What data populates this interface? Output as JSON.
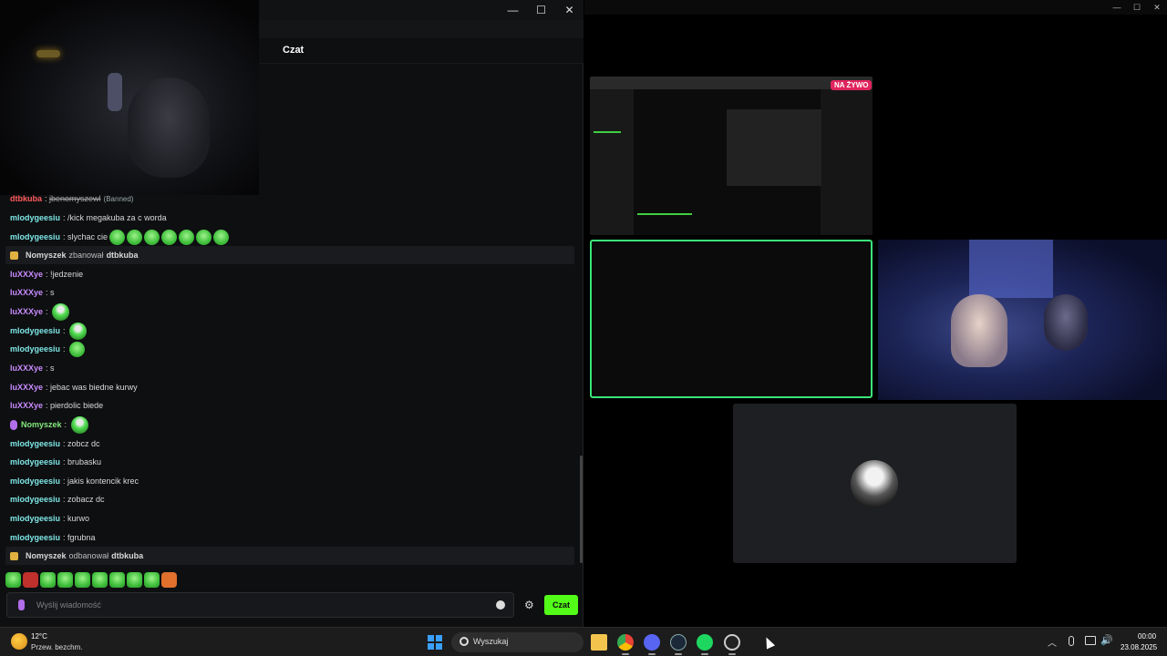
{
  "chat": {
    "header_title": "Czat",
    "window_controls": {
      "minimize": "—",
      "maximize": "☐",
      "close": "✕"
    },
    "messages": [
      {
        "user": "dtbkuba",
        "text": "jbenomyszewl",
        "note": "(Banned)"
      },
      {
        "user": "mlodygeesiu",
        "text": "/kick megakuba za c worda"
      },
      {
        "user": "mlodygeesiu",
        "text": "slychac cie"
      },
      {
        "moderator": "Nomyszek",
        "action": "zbanował",
        "target": "dtbkuba"
      },
      {
        "user": "luXXXye",
        "text": "!jedzenie"
      },
      {
        "user": "luXXXye",
        "text": "s"
      },
      {
        "user": "luXXXye",
        "text": ""
      },
      {
        "user": "mlodygeesiu",
        "text": ""
      },
      {
        "user": "mlodygeesiu",
        "text": ""
      },
      {
        "user": "luXXXye",
        "text": "s"
      },
      {
        "user": "luXXXye",
        "text": "jebac was biedne kurwy"
      },
      {
        "user": "luXXXye",
        "text": "pierdolic biede"
      },
      {
        "user": "Nomyszek",
        "text": ""
      },
      {
        "user": "mlodygeesiu",
        "text": "zobcz dc"
      },
      {
        "user": "mlodygeesiu",
        "text": "brubasku"
      },
      {
        "user": "mlodygeesiu",
        "text": "jakis kontencik krec"
      },
      {
        "user": "mlodygeesiu",
        "text": "zobacz dc"
      },
      {
        "user": "mlodygeesiu",
        "text": "kurwo"
      },
      {
        "user": "mlodygeesiu",
        "text": "fgrubna"
      },
      {
        "moderator": "Nomyszek",
        "action": "odbanował",
        "target": "dtbkuba"
      }
    ],
    "input_placeholder": "Wyślij wiadomość",
    "send_label": "Czat",
    "accent_color": "#53fc18"
  },
  "stream": {
    "live_badge": "NA ŻYWO"
  },
  "taskbar": {
    "weather_temp": "12°C",
    "weather_desc": "Przew. bezchm.",
    "search_label": "Wyszukaj",
    "clock_time": "00:00",
    "clock_date": "23.08.2025"
  }
}
